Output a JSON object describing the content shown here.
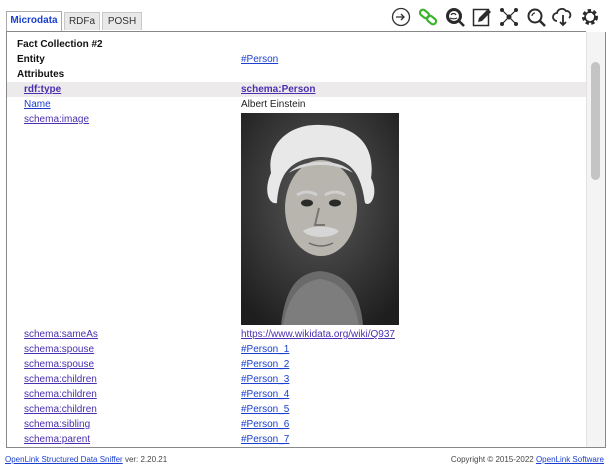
{
  "tabs": [
    {
      "label": "Microdata",
      "active": true
    },
    {
      "label": "RDFa",
      "active": false
    },
    {
      "label": "POSH",
      "active": false
    }
  ],
  "toolbar": {
    "icons": [
      "login-icon",
      "link-icon",
      "browse-icon",
      "edit-icon",
      "graph-icon",
      "search-icon",
      "download-icon",
      "settings-icon"
    ]
  },
  "collection": {
    "title": "Fact Collection #2",
    "entity_label": "Entity",
    "entity_value": "#Person",
    "attributes_label": "Attributes"
  },
  "rows": [
    {
      "key": "rdf:type",
      "value": "schema:Person",
      "highlight": true
    },
    {
      "key": "Name",
      "value": "Albert Einstein",
      "highlight": false
    }
  ],
  "image_row": {
    "key": "schema:image",
    "alt": "Albert Einstein portrait"
  },
  "more_rows": [
    {
      "key": "schema:sameAs",
      "value": "https://www.wikidata.org/wiki/Q937"
    },
    {
      "key": "schema:spouse",
      "value": "#Person_1"
    },
    {
      "key": "schema:spouse",
      "value": "#Person_2"
    },
    {
      "key": "schema:children",
      "value": "#Person_3"
    },
    {
      "key": "schema:children",
      "value": "#Person_4"
    },
    {
      "key": "schema:children",
      "value": "#Person_5"
    },
    {
      "key": "schema:sibling",
      "value": "#Person_6"
    },
    {
      "key": "schema:parent",
      "value": "#Person_7"
    }
  ],
  "footer": {
    "product_link": "OpenLink Structured Data Sniffer",
    "version": "ver: 2.20.21",
    "copyright": "Copyright © 2015-2022",
    "company_link": "OpenLink Software"
  },
  "colors": {
    "accent": "#1a3fd0",
    "link": "#4a2fb0",
    "green": "#3cb32f"
  }
}
